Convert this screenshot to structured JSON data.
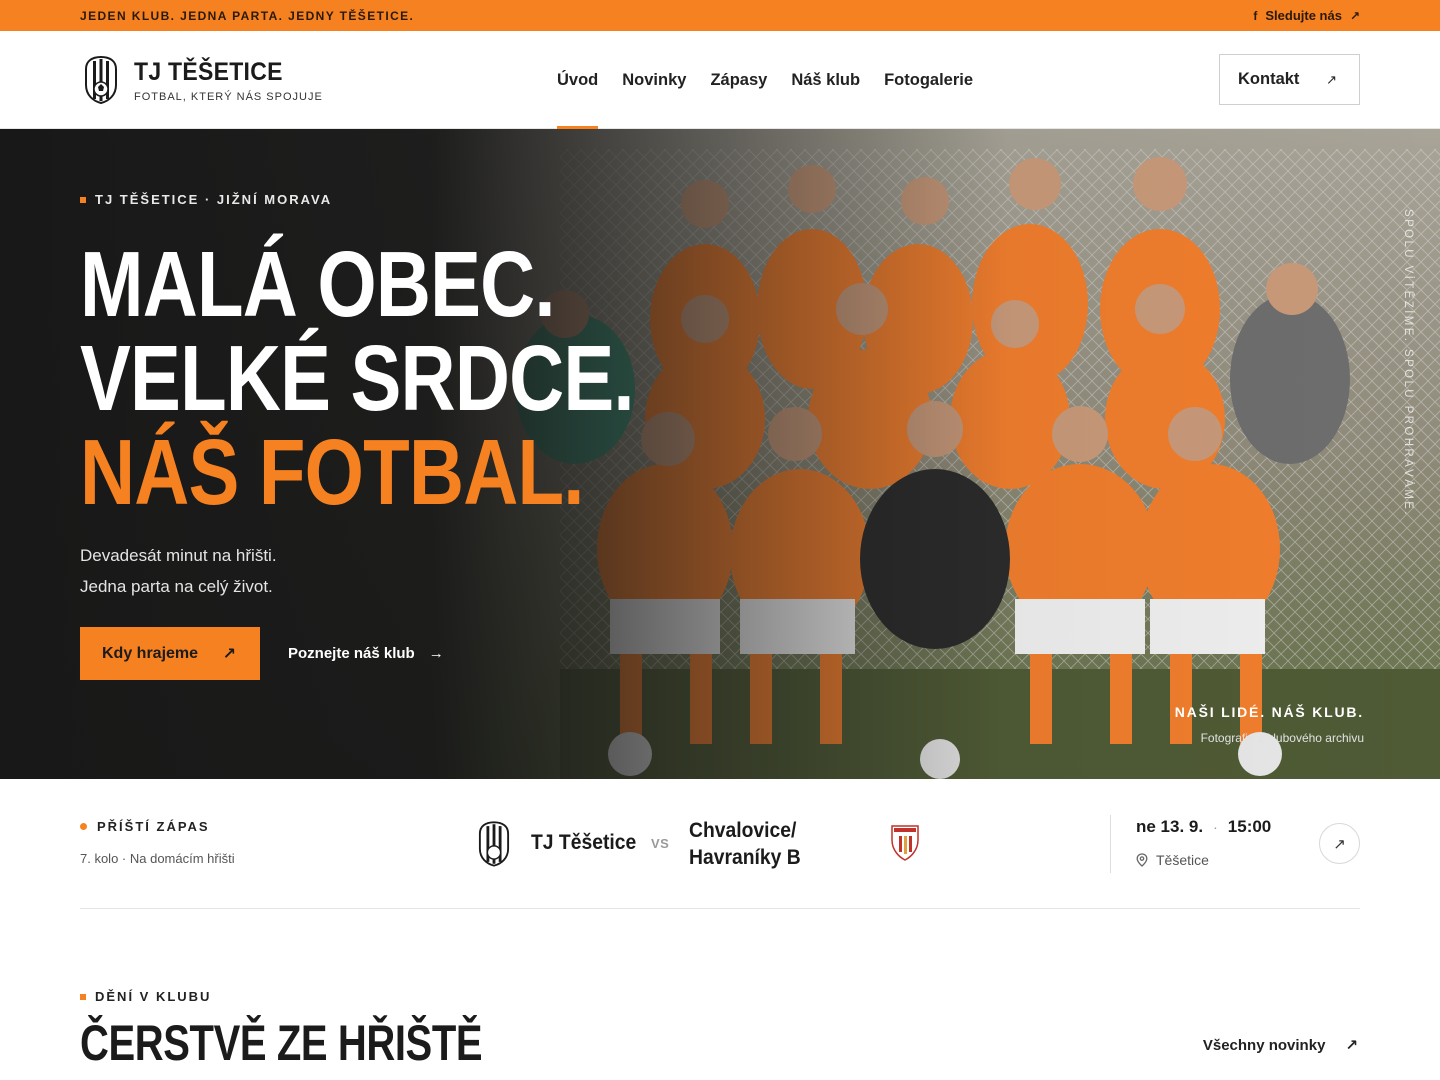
{
  "topbar": {
    "tagline": "JEDEN KLUB. JEDNA PARTA. JEDNY TĚŠETICE.",
    "follow_label": "Sledujte nás"
  },
  "header": {
    "brand_name": "TJ TĚŠETICE",
    "brand_sub": "FOTBAL, KTERÝ NÁS SPOJUJE",
    "nav": [
      "Úvod",
      "Novinky",
      "Zápasy",
      "Náš klub",
      "Fotogalerie"
    ],
    "active_nav": "Úvod",
    "contact_label": "Kontakt"
  },
  "hero": {
    "eyebrow": "TJ TĚŠETICE · JIŽNÍ MORAVA",
    "headline_1": "MALÁ OBEC.",
    "headline_2": "VELKÉ SRDCE.",
    "headline_3": "NÁŠ FOTBAL.",
    "lead_1": "Devadesát minut na hřišti.",
    "lead_2": "Jedna parta na celý život.",
    "primary_cta": "Kdy hrajeme",
    "secondary_cta": "Poznejte náš klub",
    "vertical_text": "SPOLU VÍTĚZÍME. SPOLU PROHRÁVÁME.",
    "caption_title": "NAŠI LIDÉ. NÁŠ KLUB.",
    "caption_sub": "Fotografie z klubového archivu"
  },
  "next_match": {
    "label": "PŘÍŠTÍ ZÁPAS",
    "meta": "7. kolo · Na domácím hřišti",
    "home_team": "TJ Těšetice",
    "vs": "VS",
    "away_team_line1": "Chvalovice/",
    "away_team_line2": "Havraníky B",
    "date": "ne 13. 9.",
    "separator": "·",
    "time": "15:00",
    "venue": "Těšetice"
  },
  "news": {
    "eyebrow": "DĚNÍ V KLUBU",
    "title": "ČERSTVĚ ZE HŘIŠTĚ",
    "all_link": "Všechny novinky"
  },
  "colors": {
    "accent": "#f68121",
    "dark": "#1b1b1b"
  },
  "icons": [
    "facebook-icon",
    "arrow-up-right-icon",
    "arrow-right-icon",
    "map-pin-icon",
    "club-crest-icon",
    "opponent-crest-icon"
  ]
}
